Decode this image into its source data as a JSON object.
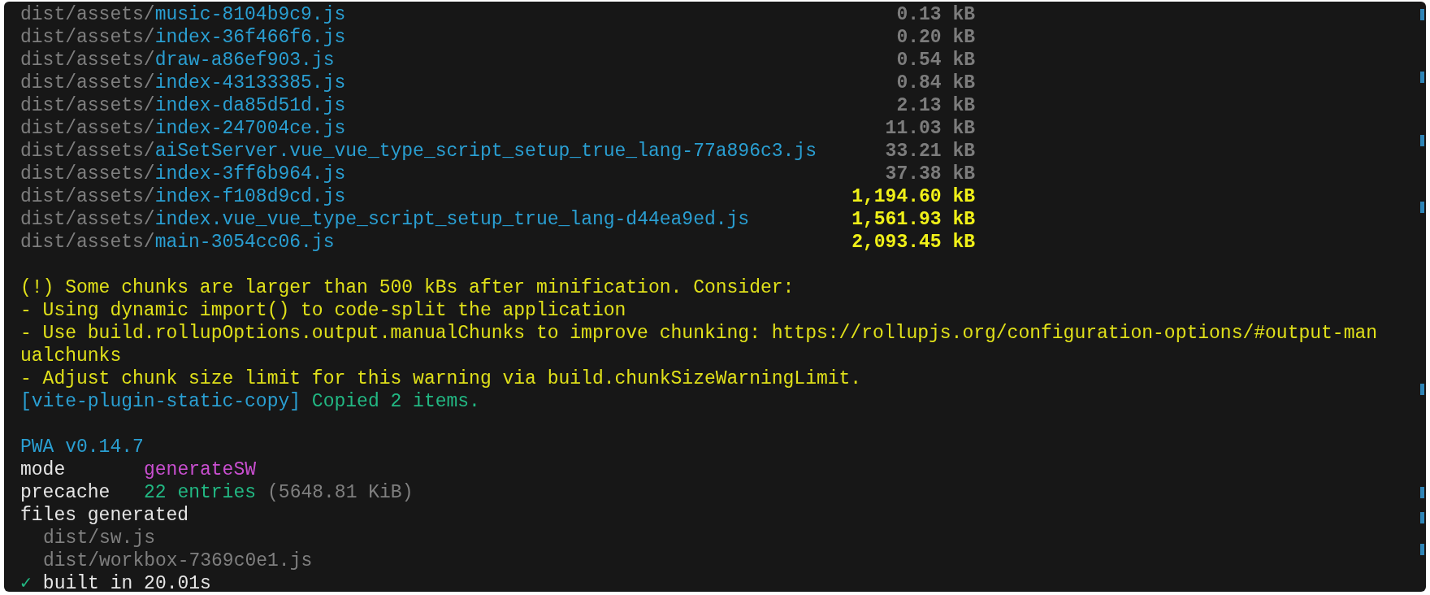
{
  "assets": [
    {
      "dir": "dist/assets/",
      "file": "music-8104b9c9.js",
      "size": "0.13 kB",
      "kind": "normal"
    },
    {
      "dir": "dist/assets/",
      "file": "index-36f466f6.js",
      "size": "0.20 kB",
      "kind": "normal"
    },
    {
      "dir": "dist/assets/",
      "file": "draw-a86ef903.js",
      "size": "0.54 kB",
      "kind": "normal"
    },
    {
      "dir": "dist/assets/",
      "file": "index-43133385.js",
      "size": "0.84 kB",
      "kind": "normal"
    },
    {
      "dir": "dist/assets/",
      "file": "index-da85d51d.js",
      "size": "2.13 kB",
      "kind": "normal"
    },
    {
      "dir": "dist/assets/",
      "file": "index-247004ce.js",
      "size": "11.03 kB",
      "kind": "normal"
    },
    {
      "dir": "dist/assets/",
      "file": "aiSetServer.vue_vue_type_script_setup_true_lang-77a896c3.js",
      "size": "33.21 kB",
      "kind": "normal"
    },
    {
      "dir": "dist/assets/",
      "file": "index-3ff6b964.js",
      "size": "37.38 kB",
      "kind": "normal"
    },
    {
      "dir": "dist/assets/",
      "file": "index-f108d9cd.js",
      "size": "1,194.60 kB",
      "kind": "large"
    },
    {
      "dir": "dist/assets/",
      "file": "index.vue_vue_type_script_setup_true_lang-d44ea9ed.js",
      "size": "1,561.93 kB",
      "kind": "large"
    },
    {
      "dir": "dist/assets/",
      "file": "main-3054cc06.js",
      "size": "2,093.45 kB",
      "kind": "large"
    }
  ],
  "warning": {
    "lines": [
      "(!) Some chunks are larger than 500 kBs after minification. Consider:",
      "- Using dynamic import() to code-split the application",
      "- Use build.rollupOptions.output.manualChunks to improve chunking: https://rollupjs.org/configuration-options/#output-man",
      "ualchunks",
      "- Adjust chunk size limit for this warning via build.chunkSizeWarningLimit."
    ]
  },
  "plugin": {
    "tag": "[vite-plugin-static-copy]",
    "message": "Copied 2 items."
  },
  "pwa": {
    "title": "PWA v0.14.7",
    "fields": [
      {
        "label": "mode",
        "value": "generateSW",
        "kind": "mode"
      },
      {
        "label": "precache",
        "value": "22 entries",
        "detail": "(5648.81 KiB)",
        "kind": "count"
      }
    ],
    "files_heading": "files generated",
    "files": [
      "dist/sw.js",
      "dist/workbox-7369c0e1.js"
    ]
  },
  "result": {
    "mark": "✓",
    "text": "built in 20.01s"
  }
}
